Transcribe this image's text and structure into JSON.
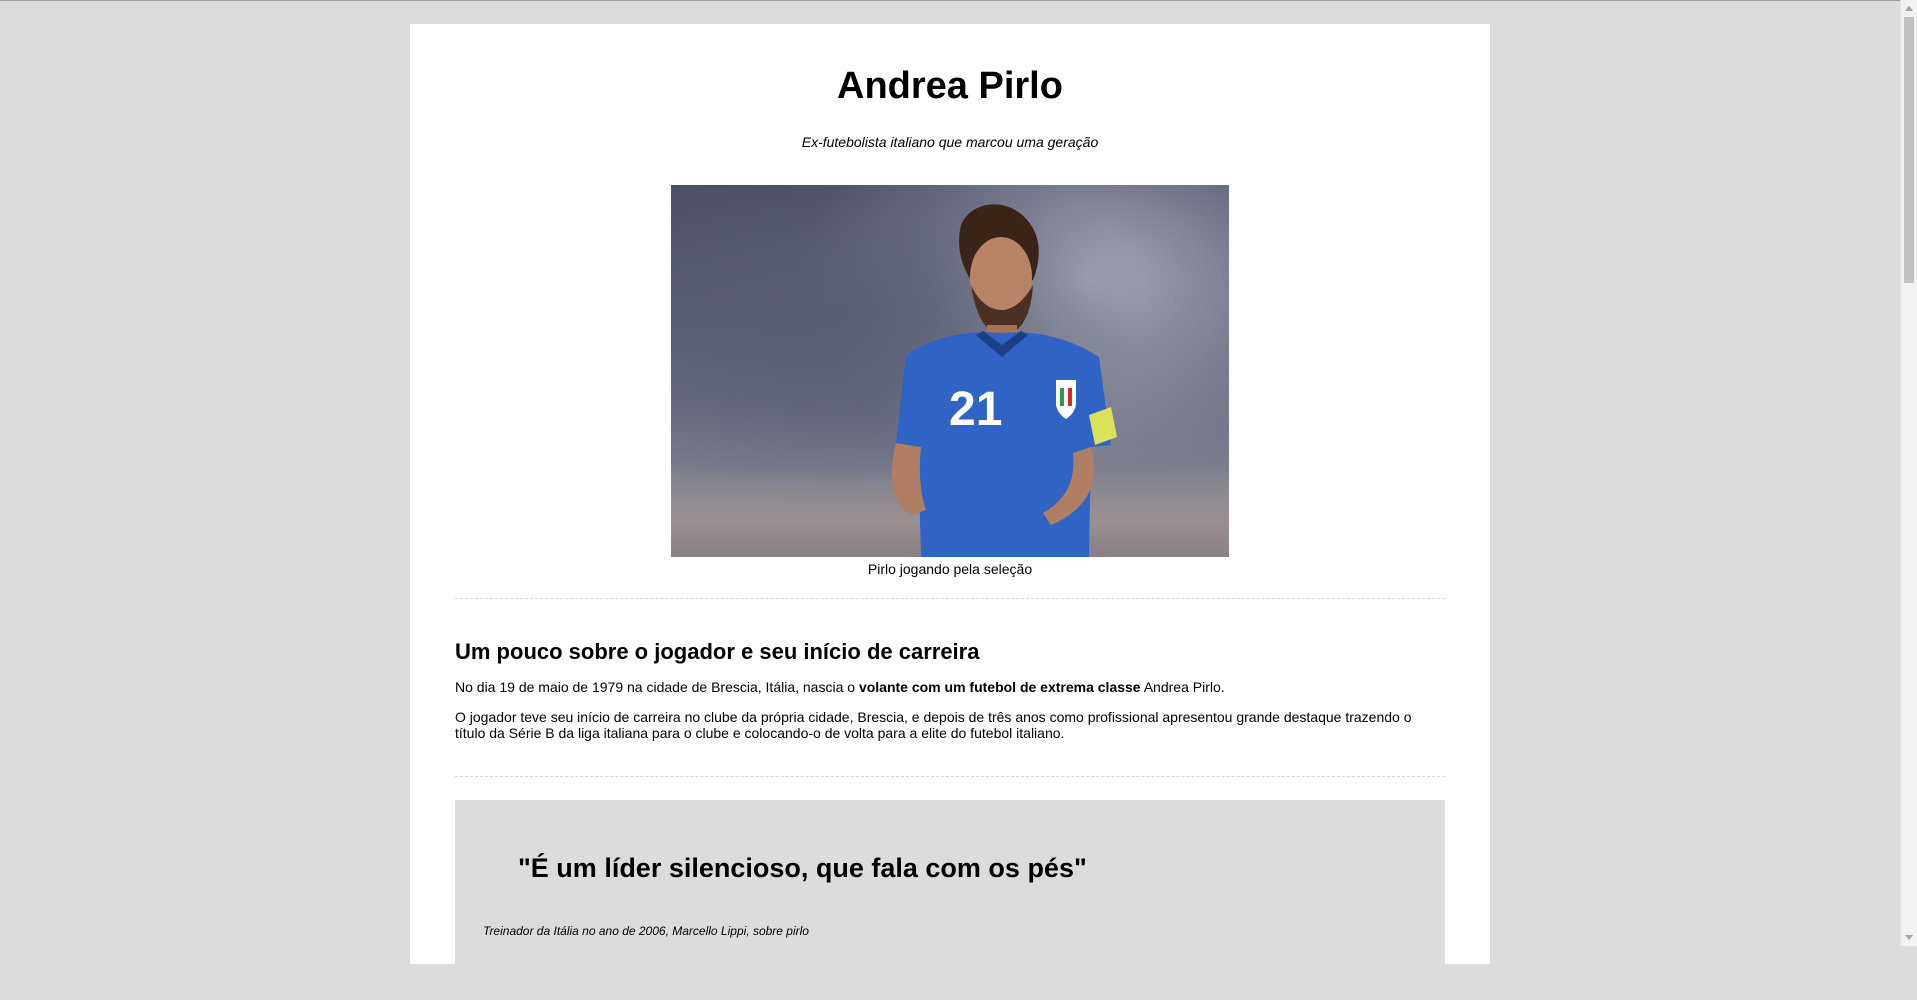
{
  "header": {
    "title": "Andrea Pirlo",
    "subtitle": "Ex-futebolista italiano que marcou uma geração"
  },
  "figure": {
    "image_alt": "Pirlo jogando pela seleção",
    "jersey_number": "21",
    "caption": "Pirlo jogando pela seleção"
  },
  "section": {
    "title": "Um pouco sobre o jogador e seu início de carreira",
    "para1_before": "No dia 19 de maio de 1979 na cidade de Brescia, Itália, nascia o ",
    "para1_bold": "volante com um futebol de extrema classe",
    "para1_after": " Andrea Pirlo.",
    "para2": "O jogador teve seu início de carreira no clube da própria cidade, Brescia, e depois de três anos como profissional apresentou grande destaque trazendo o título da Série B da liga italiana para o clube e colocando-o de volta para a elite do futebol italiano."
  },
  "quote": {
    "text": "\"É um líder silencioso, que fala com os pés\"",
    "cite": "Treinador da Itália no ano de 2006, Marcello Lippi, sobre pirlo"
  },
  "colors": {
    "background": "#dcdcdc",
    "page": "#ffffff",
    "jersey": "#2f63c4"
  }
}
